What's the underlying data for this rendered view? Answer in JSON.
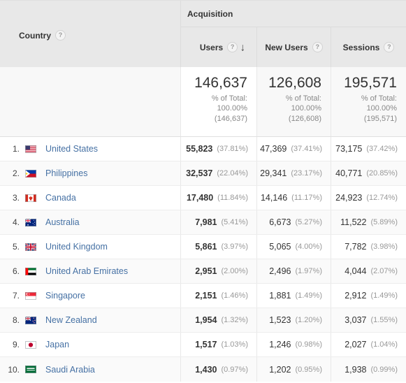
{
  "header": {
    "dimension_label": "Country",
    "dimension_help": "?",
    "group_label": "Acquisition",
    "metrics": [
      {
        "label": "Users",
        "help": "?",
        "sorted": true,
        "sort_icon": "arrow-down-icon"
      },
      {
        "label": "New Users",
        "help": "?",
        "sorted": false
      },
      {
        "label": "Sessions",
        "help": "?",
        "sorted": false
      }
    ]
  },
  "summary": {
    "users": {
      "value": "146,637",
      "line1": "% of Total:",
      "line2": "100.00%",
      "line3": "(146,637)"
    },
    "new_users": {
      "value": "126,608",
      "line1": "% of Total:",
      "line2": "100.00%",
      "line3": "(126,608)"
    },
    "sessions": {
      "value": "195,571",
      "line1": "% of Total:",
      "line2": "100.00%",
      "line3": "(195,571)"
    }
  },
  "colors": {
    "link": "#4671a4",
    "header_bg": "#e8e8e8",
    "alt_row_bg": "#fafafa",
    "muted_text": "#999999"
  },
  "rows": [
    {
      "rank": "1.",
      "country": "United States",
      "flag": "flag-us",
      "users": "55,823",
      "users_pct": "(37.81%)",
      "new_users": "47,369",
      "new_users_pct": "(37.41%)",
      "sessions": "73,175",
      "sessions_pct": "(37.42%)"
    },
    {
      "rank": "2.",
      "country": "Philippines",
      "flag": "flag-ph",
      "users": "32,537",
      "users_pct": "(22.04%)",
      "new_users": "29,341",
      "new_users_pct": "(23.17%)",
      "sessions": "40,771",
      "sessions_pct": "(20.85%)"
    },
    {
      "rank": "3.",
      "country": "Canada",
      "flag": "flag-ca",
      "users": "17,480",
      "users_pct": "(11.84%)",
      "new_users": "14,146",
      "new_users_pct": "(11.17%)",
      "sessions": "24,923",
      "sessions_pct": "(12.74%)"
    },
    {
      "rank": "4.",
      "country": "Australia",
      "flag": "flag-au",
      "users": "7,981",
      "users_pct": "(5.41%)",
      "new_users": "6,673",
      "new_users_pct": "(5.27%)",
      "sessions": "11,522",
      "sessions_pct": "(5.89%)"
    },
    {
      "rank": "5.",
      "country": "United Kingdom",
      "flag": "flag-gb",
      "users": "5,861",
      "users_pct": "(3.97%)",
      "new_users": "5,065",
      "new_users_pct": "(4.00%)",
      "sessions": "7,782",
      "sessions_pct": "(3.98%)"
    },
    {
      "rank": "6.",
      "country": "United Arab Emirates",
      "flag": "flag-ae",
      "users": "2,951",
      "users_pct": "(2.00%)",
      "new_users": "2,496",
      "new_users_pct": "(1.97%)",
      "sessions": "4,044",
      "sessions_pct": "(2.07%)"
    },
    {
      "rank": "7.",
      "country": "Singapore",
      "flag": "flag-sg",
      "users": "2,151",
      "users_pct": "(1.46%)",
      "new_users": "1,881",
      "new_users_pct": "(1.49%)",
      "sessions": "2,912",
      "sessions_pct": "(1.49%)"
    },
    {
      "rank": "8.",
      "country": "New Zealand",
      "flag": "flag-nz",
      "users": "1,954",
      "users_pct": "(1.32%)",
      "new_users": "1,523",
      "new_users_pct": "(1.20%)",
      "sessions": "3,037",
      "sessions_pct": "(1.55%)"
    },
    {
      "rank": "9.",
      "country": "Japan",
      "flag": "flag-jp",
      "users": "1,517",
      "users_pct": "(1.03%)",
      "new_users": "1,246",
      "new_users_pct": "(0.98%)",
      "sessions": "2,027",
      "sessions_pct": "(1.04%)"
    },
    {
      "rank": "10.",
      "country": "Saudi Arabia",
      "flag": "flag-sa",
      "users": "1,430",
      "users_pct": "(0.97%)",
      "new_users": "1,202",
      "new_users_pct": "(0.95%)",
      "sessions": "1,938",
      "sessions_pct": "(0.99%)"
    }
  ]
}
